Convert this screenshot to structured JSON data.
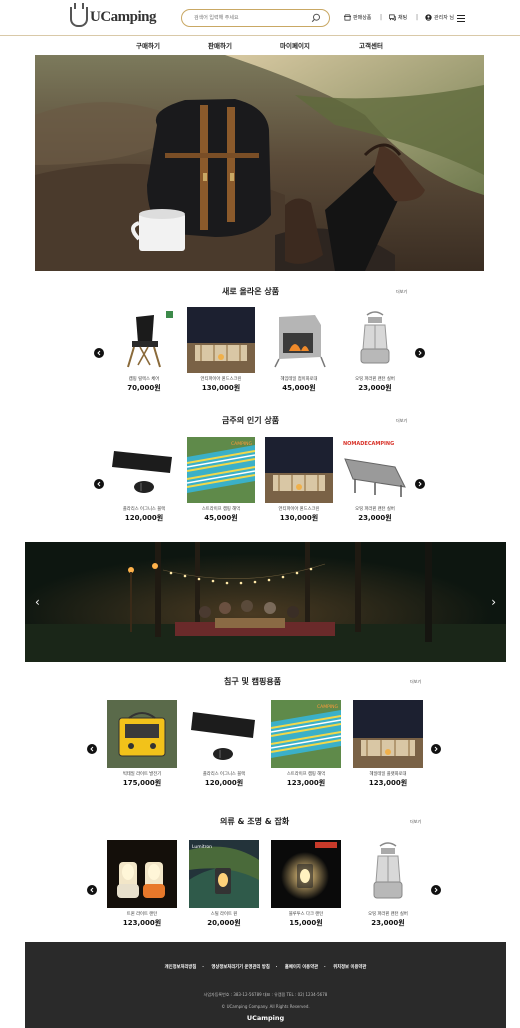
{
  "header": {
    "logo_text": "UCamping",
    "search_placeholder": "검색어 입력해 주세요",
    "menu": [
      {
        "label": "판매상품",
        "icon": "store-icon"
      },
      {
        "label": "채팅",
        "icon": "chat-icon"
      },
      {
        "label": "관리자 님",
        "icon": "user-icon"
      }
    ]
  },
  "nav": [
    "구매하기",
    "판매하기",
    "마이페이지",
    "고객센터"
  ],
  "sections": [
    {
      "title": "새로 올라온 상품",
      "more": "더보기",
      "items": [
        {
          "name": "캠핑 릴렉스 체어",
          "price": "70,000원"
        },
        {
          "name": "언티파이아 윈드스크린",
          "price": "130,000원"
        },
        {
          "name": "헤임테일 접이화로대",
          "price": "45,000원"
        },
        {
          "name": "오띵 파라핀 랜턴 실버",
          "price": "23,000원"
        }
      ]
    },
    {
      "title": "금주의 인기 상품",
      "more": "더보기",
      "items": [
        {
          "name": "플라리스 이그니스 블랙",
          "price": "120,000원"
        },
        {
          "name": "스트라이프 캠핑 해먹",
          "price": "45,000원"
        },
        {
          "name": "언티파이아 윈드스크린",
          "price": "130,000원"
        },
        {
          "name": "오띵 파라핀 랜턴 실버",
          "price": "23,000원"
        }
      ]
    },
    {
      "title": "침구 및 캠핑용품",
      "more": "더보기",
      "items": [
        {
          "name": "빅테일 라이트 발전기",
          "price": "175,000원"
        },
        {
          "name": "플라리스 이그니스 블랙",
          "price": "120,000원"
        },
        {
          "name": "스트라이프 캠핑 해먹",
          "price": "123,000원"
        },
        {
          "name": "헤일테일 플랫화로대",
          "price": "123,000원"
        }
      ]
    },
    {
      "title": "의류 & 조명 & 잡화",
      "more": "더보기",
      "items": [
        {
          "name": "트윈 라이트 랜턴",
          "price": "123,000원"
        },
        {
          "name": "스틸 라이트 원",
          "price": "20,000원"
        },
        {
          "name": "블루투스 다크 랜턴",
          "price": "15,000원"
        },
        {
          "name": "오띵 파라핀 랜턴 실버",
          "price": "23,000원"
        }
      ]
    }
  ],
  "footer": {
    "links": [
      "개인정보처리방침",
      "영상정보처리기기 운영관리 방침",
      "홈페이지 이용약관",
      "위치정보 이용약관"
    ],
    "info": "사업자등록번호 : 383-12-56789    대표 : 유캠핑    TEL : 02) 1234-5678",
    "copyright": "© UCamping Company. All Rights Reserved.",
    "brand": "UCamping"
  },
  "colors": {
    "accent": "#c9a864",
    "footer_bg": "#2a2a2a"
  }
}
